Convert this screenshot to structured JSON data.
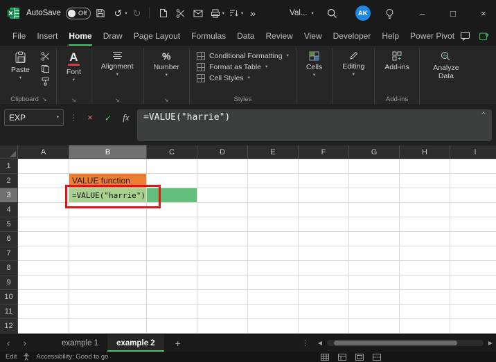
{
  "titlebar": {
    "autosave_label": "AutoSave",
    "autosave_state": "Off",
    "style_dropdown": "Val...",
    "avatar_initials": "AK"
  },
  "icons": {
    "undo": "↺",
    "redo": "↻",
    "overflow": "»",
    "chevron_down": "▾",
    "collapse": "^",
    "cancel": "×",
    "check": "✓",
    "fx": "fx",
    "font": "A",
    "number": "%",
    "minimize": "–",
    "maximize": "□",
    "close": "×",
    "dots": "⋮",
    "tab_prev": "‹",
    "tab_next": "›",
    "add_sheet": "+",
    "scroll_left": "◀",
    "scroll_right": "▶"
  },
  "menubar": {
    "items": [
      "File",
      "Insert",
      "Home",
      "Draw",
      "Page Layout",
      "Formulas",
      "Data",
      "Review",
      "View",
      "Developer",
      "Help",
      "Power Pivot"
    ],
    "active": "Home"
  },
  "ribbon": {
    "paste_label": "Paste",
    "clipboard_group_label": "Clipboard",
    "font_label": "Font",
    "alignment_label": "Alignment",
    "number_label": "Number",
    "styles_buttons": [
      "Conditional Formatting",
      "Format as Table",
      "Cell Styles"
    ],
    "styles_group_label": "Styles",
    "cells_label": "Cells",
    "editing_label": "Editing",
    "addins_label": "Add-ins",
    "addins_group_label": "Add-ins",
    "analyze_label": "Analyze Data"
  },
  "formula_bar": {
    "name_box_value": "EXP",
    "formula": "=VALUE(\"harrie\")"
  },
  "grid": {
    "column_headers": [
      "A",
      "B",
      "C",
      "D",
      "E",
      "F",
      "G",
      "H",
      "I"
    ],
    "row_headers": [
      "1",
      "2",
      "3",
      "4",
      "5",
      "6",
      "7",
      "8",
      "9",
      "10",
      "11",
      "12"
    ],
    "selected_column": "B",
    "selected_row": "3",
    "annotation_color": "#E01515",
    "cells": [
      {
        "ref": "B2",
        "text": "VALUE function",
        "fill": "#ED7D31",
        "text_color": "#1a1a1a"
      },
      {
        "ref": "B3",
        "text": "=VALUE(\"harrie\")",
        "fill": "#A9D08E",
        "text_color": "#111111"
      },
      {
        "ref": "C3",
        "text": "",
        "fill": "#63BE7B"
      }
    ]
  },
  "sheet_tabs": {
    "tabs": [
      "example 1",
      "example 2"
    ],
    "active": "example 2"
  },
  "status_bar": {
    "mode": "Edit",
    "accessibility": "Accessibility: Good to go"
  }
}
